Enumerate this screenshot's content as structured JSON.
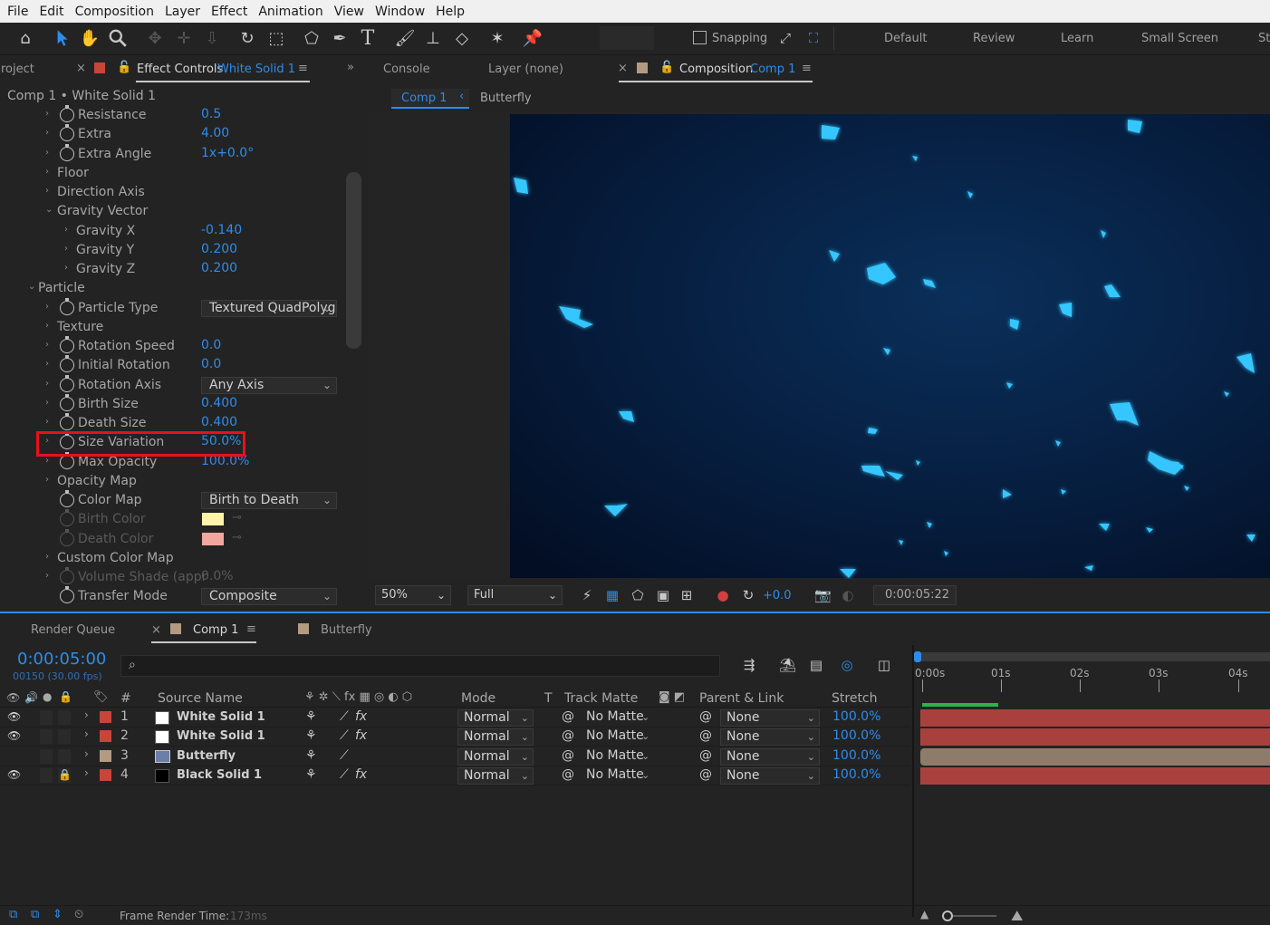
{
  "menu": [
    "File",
    "Edit",
    "Composition",
    "Layer",
    "Effect",
    "Animation",
    "View",
    "Window",
    "Help"
  ],
  "toolbar": {
    "snapping_label": "Snapping",
    "workspaces": [
      "Default",
      "Review",
      "Learn",
      "Small Screen",
      "St"
    ]
  },
  "effect_panel": {
    "project_tab": "roject",
    "tab_title": "Effect Controls",
    "tab_layer": "White Solid 1",
    "breadcrumb": "Comp 1 • White Solid 1",
    "rows": [
      {
        "label": "Resistance",
        "value": "0.5"
      },
      {
        "label": "Extra",
        "value": "4.00"
      },
      {
        "label": "Extra Angle",
        "value": "1x+0.0°"
      },
      {
        "label": "Floor",
        "value": ""
      },
      {
        "label": "Direction Axis",
        "value": ""
      },
      {
        "label": "Gravity Vector",
        "value": ""
      },
      {
        "label": "Gravity X",
        "value": "-0.140"
      },
      {
        "label": "Gravity Y",
        "value": "0.200"
      },
      {
        "label": "Gravity Z",
        "value": "0.200"
      },
      {
        "label": "Particle",
        "value": ""
      },
      {
        "label": "Particle Type",
        "value": "Textured QuadPolygon"
      },
      {
        "label": "Texture",
        "value": ""
      },
      {
        "label": "Rotation Speed",
        "value": "0.0"
      },
      {
        "label": "Initial Rotation",
        "value": "0.0"
      },
      {
        "label": "Rotation Axis",
        "value": "Any Axis"
      },
      {
        "label": "Birth Size",
        "value": "0.400"
      },
      {
        "label": "Death Size",
        "value": "0.400"
      },
      {
        "label": "Size Variation",
        "value": "50.0%"
      },
      {
        "label": "Max Opacity",
        "value": "100.0%"
      },
      {
        "label": "Opacity Map",
        "value": ""
      },
      {
        "label": "Color Map",
        "value": "Birth to Death"
      },
      {
        "label": "Birth Color",
        "value": ""
      },
      {
        "label": "Death Color",
        "value": ""
      },
      {
        "label": "Custom Color Map",
        "value": ""
      },
      {
        "label": "Volume Shade (appr",
        "value": "0.0%"
      },
      {
        "label": "Transfer Mode",
        "value": "Composite"
      }
    ],
    "birth_color": "#fff4a8",
    "death_color": "#f2a6a0"
  },
  "comp_panel": {
    "tabs": [
      "Console",
      "Layer (none)",
      "Composition",
      "Comp 1"
    ],
    "sub_tabs": [
      "Comp 1",
      "Butterfly"
    ],
    "zoom": "50%",
    "resolution": "Full",
    "exposure": "+0.0",
    "timecode": "0:00:05:22"
  },
  "timeline": {
    "tabs": [
      "Render Queue",
      "Comp 1",
      "Butterfly"
    ],
    "current_time": "0:00:05:00",
    "frame_info": "00150 (30.00 fps)",
    "search_placeholder": "",
    "headers": {
      "number": "#",
      "source": "Source Name",
      "mode": "Mode",
      "t": "T",
      "track_matte": "Track Matte",
      "parent": "Parent & Link",
      "stretch": "Stretch"
    },
    "ruler": [
      "0:00s",
      "01s",
      "02s",
      "03s",
      "04s"
    ],
    "layers": [
      {
        "num": "1",
        "name": "White Solid 1",
        "mode": "Normal",
        "matte": "No Matte",
        "parent": "None",
        "stretch": "100.0%",
        "label_color": "#c8453a",
        "swatch": "#ffffff",
        "bar_color": "#a8413d"
      },
      {
        "num": "2",
        "name": "White Solid 1",
        "mode": "Normal",
        "matte": "No Matte",
        "parent": "None",
        "stretch": "100.0%",
        "label_color": "#c8453a",
        "swatch": "#ffffff",
        "bar_color": "#a8413d"
      },
      {
        "num": "3",
        "name": "Butterfly",
        "mode": "Normal",
        "matte": "No Matte",
        "parent": "None",
        "stretch": "100.0%",
        "label_color": "#b39b83",
        "swatch": "comp",
        "bar_color": "#8e7c6b"
      },
      {
        "num": "4",
        "name": "Black Solid 1",
        "mode": "Normal",
        "matte": "No Matte",
        "parent": "None",
        "stretch": "100.0%",
        "label_color": "#c8453a",
        "swatch": "#000000",
        "bar_color": "#a8413d"
      }
    ],
    "footer": {
      "label": "Frame Render Time:",
      "value": "173ms"
    }
  }
}
